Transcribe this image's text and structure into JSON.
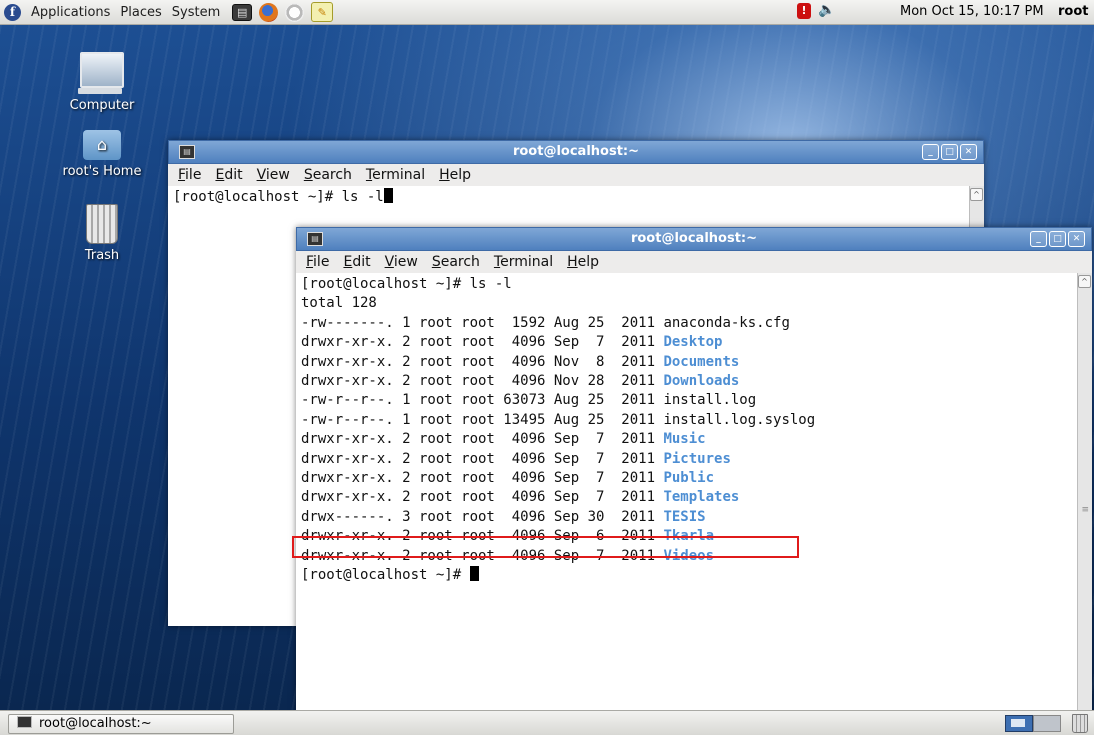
{
  "top_panel": {
    "menus": [
      "Applications",
      "Places",
      "System"
    ],
    "clock": "Mon Oct 15, 10:17 PM",
    "user": "root"
  },
  "desktop_icons": {
    "computer": "Computer",
    "home": "root's Home",
    "trash": "Trash"
  },
  "back_window": {
    "title": "root@localhost:~",
    "menu": [
      "File",
      "Edit",
      "View",
      "Search",
      "Terminal",
      "Help"
    ],
    "prompt": "[root@localhost ~]# ls -l"
  },
  "front_window": {
    "title": "root@localhost:~",
    "menu": [
      "File",
      "Edit",
      "View",
      "Search",
      "Terminal",
      "Help"
    ],
    "command_line": "[root@localhost ~]# ls -l",
    "total": "total 128",
    "listing": [
      {
        "prefix": "-rw-------. 1 root root  1592 Aug 25  2011 ",
        "name": "anaconda-ks.cfg",
        "dir": false
      },
      {
        "prefix": "drwxr-xr-x. 2 root root  4096 Sep  7  2011 ",
        "name": "Desktop",
        "dir": true
      },
      {
        "prefix": "drwxr-xr-x. 2 root root  4096 Nov  8  2011 ",
        "name": "Documents",
        "dir": true
      },
      {
        "prefix": "drwxr-xr-x. 2 root root  4096 Nov 28  2011 ",
        "name": "Downloads",
        "dir": true
      },
      {
        "prefix": "-rw-r--r--. 1 root root 63073 Aug 25  2011 ",
        "name": "install.log",
        "dir": false
      },
      {
        "prefix": "-rw-r--r--. 1 root root 13495 Aug 25  2011 ",
        "name": "install.log.syslog",
        "dir": false
      },
      {
        "prefix": "drwxr-xr-x. 2 root root  4096 Sep  7  2011 ",
        "name": "Music",
        "dir": true
      },
      {
        "prefix": "drwxr-xr-x. 2 root root  4096 Sep  7  2011 ",
        "name": "Pictures",
        "dir": true
      },
      {
        "prefix": "drwxr-xr-x. 2 root root  4096 Sep  7  2011 ",
        "name": "Public",
        "dir": true
      },
      {
        "prefix": "drwxr-xr-x. 2 root root  4096 Sep  7  2011 ",
        "name": "Templates",
        "dir": true
      },
      {
        "prefix": "drwx------. 3 root root  4096 Sep 30  2011 ",
        "name": "TESIS",
        "dir": true
      },
      {
        "prefix": "drwxr-xr-x. 2 root root  4096 Sep  6  2011 ",
        "name": "Tkarla",
        "dir": true
      },
      {
        "prefix": "drwxr-xr-x. 2 root root  4096 Sep  7  2011 ",
        "name": "Videos",
        "dir": true
      }
    ],
    "final_prompt": "[root@localhost ~]# "
  },
  "bottom_panel": {
    "task_label": "root@localhost:~"
  }
}
